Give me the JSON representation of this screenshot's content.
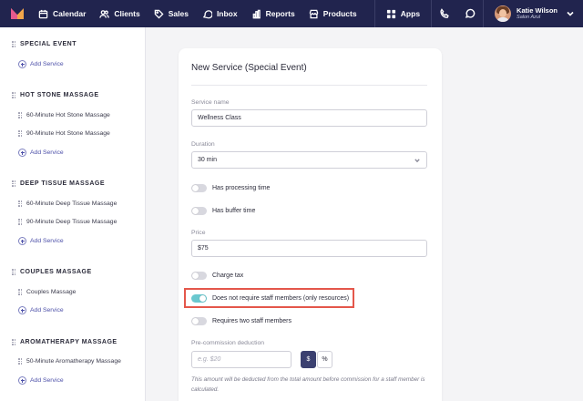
{
  "nav": {
    "items": [
      {
        "label": "Calendar",
        "icon": "calendar-icon"
      },
      {
        "label": "Clients",
        "icon": "users-icon"
      },
      {
        "label": "Sales",
        "icon": "tag-icon"
      },
      {
        "label": "Inbox",
        "icon": "inbox-icon"
      },
      {
        "label": "Reports",
        "icon": "bar-chart-icon"
      },
      {
        "label": "Products",
        "icon": "shop-icon"
      }
    ],
    "apps_label": "Apps",
    "user": {
      "name": "Katie Wilson",
      "location": "Salon Azul"
    },
    "bar_color": "#21244e"
  },
  "sidebar": {
    "add_label": "Add Service",
    "categories": [
      {
        "title": "SPECIAL EVENT",
        "services": []
      },
      {
        "title": "HOT STONE MASSAGE",
        "services": [
          "60-Minute Hot Stone Massage",
          "90-Minute Hot Stone Massage"
        ]
      },
      {
        "title": "DEEP TISSUE MASSAGE",
        "services": [
          "60-Minute Deep Tissue Massage",
          "90-Minute Deep Tissue Massage"
        ]
      },
      {
        "title": "COUPLES MASSAGE",
        "services": [
          "Couples Massage"
        ]
      },
      {
        "title": "AROMATHERAPY MASSAGE",
        "services": [
          "50-Minute Aromatherapy Massage"
        ]
      }
    ]
  },
  "form": {
    "title": "New Service (Special Event)",
    "service_name": {
      "label": "Service name",
      "value": "Wellness Class"
    },
    "duration": {
      "label": "Duration",
      "value": "30 min"
    },
    "toggles": [
      {
        "label": "Has processing time",
        "on": false
      },
      {
        "label": "Has buffer time",
        "on": false
      }
    ],
    "price": {
      "label": "Price",
      "value": "$75"
    },
    "toggles2": [
      {
        "label": "Charge tax",
        "on": false
      },
      {
        "label": "Does not require staff members (only resources)",
        "on": true
      },
      {
        "label": "Requires two staff members",
        "on": false
      }
    ],
    "deduction": {
      "label": "Pre-commission deduction",
      "placeholder": "e.g. $20",
      "unit_dollar": "$",
      "unit_percent": "%",
      "note": "This amount will be deducted from the total amount before commission for a staff member is calculated."
    },
    "accent_toggle_color": "#6ac8cf",
    "highlight_color": "#e4574b"
  }
}
